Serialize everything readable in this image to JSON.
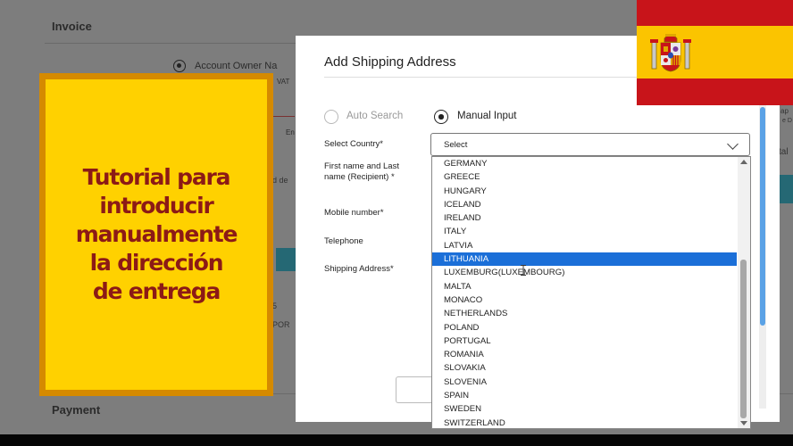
{
  "background": {
    "invoice_title": "Invoice",
    "account_owner_option": "Account Owner Na",
    "vat_fragment": "VAT",
    "en_fragment": "En",
    "d_fragment": "d de",
    "five_fragment": "5",
    "por_fragment": "POR",
    "payment_title": "Payment",
    "right_ap": "ap",
    "right_td": "e D",
    "right_tal": "tal"
  },
  "tutorial": {
    "text": "Tutorial para\nintroducir\nmanualmente\nla dirección\nde entrega",
    "colors": {
      "background": "#ffd100",
      "border": "#d58a00",
      "text": "#8c1a16"
    }
  },
  "modal": {
    "title": "Add Shipping Address",
    "auto_search_label": "Auto Search",
    "manual_input_label": "Manual Input",
    "selected_mode": "Manual Input",
    "labels": {
      "select_country": "Select Country*",
      "name": "First name and Last\nname (Recipient) *",
      "mobile": "Mobile number*",
      "telephone": "Telephone",
      "shipping_address": "Shipping Address*"
    },
    "country_select_value": "Select"
  },
  "dropdown": {
    "options": [
      "GERMANY",
      "GREECE",
      "HUNGARY",
      "ICELAND",
      "IRELAND",
      "ITALY",
      "LATVIA",
      "LITHUANIA",
      "LUXEMBURG(LUXEMBOURG)",
      "MALTA",
      "MONACO",
      "NETHERLANDS",
      "POLAND",
      "PORTUGAL",
      "ROMANIA",
      "SLOVAKIA",
      "SLOVENIA",
      "SPAIN",
      "SWEDEN",
      "SWITZERLAND"
    ],
    "highlighted": "LITHUANIA",
    "highlight_color": "#1b6fd8"
  },
  "flag": {
    "icon": "spain-flag-icon",
    "colors": {
      "red": "#c8141a",
      "yellow": "#fbc400"
    }
  }
}
